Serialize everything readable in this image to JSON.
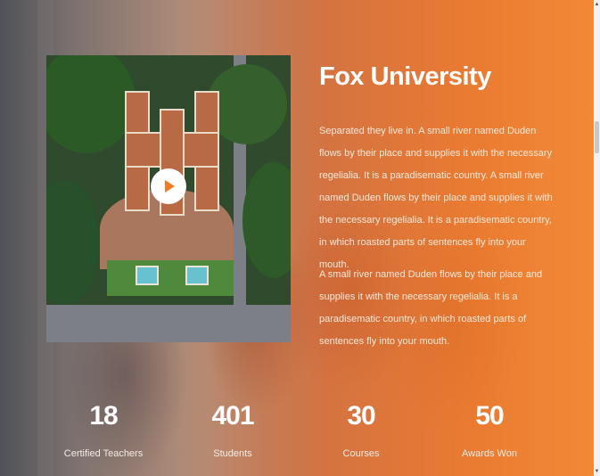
{
  "about": {
    "title": "Fox University",
    "paragraph1": "Separated they live in. A small river named Duden flows by their place and supplies it with the necessary regelialia. It is a paradisematic country. A small river named Duden flows by their place and supplies it with the necessary regelialia. It is a paradisematic country, in which roasted parts of sentences fly into your mouth.",
    "paragraph2": "A small river named Duden flows by their place and supplies it with the necessary regelialia. It is a paradisematic country, in which roasted parts of sentences fly into your mouth.",
    "video_icon": "play-icon"
  },
  "stats": [
    {
      "number": "18",
      "label": "Certified Teachers"
    },
    {
      "number": "401",
      "label": "Students"
    },
    {
      "number": "30",
      "label": "Courses"
    },
    {
      "number": "50",
      "label": "Awards Won"
    }
  ],
  "colors": {
    "accent": "#f37c22",
    "play_icon": "#f37c22",
    "text": "#ffffff"
  },
  "scrollbar": {
    "up_icon": "scroll-up-arrow",
    "down_icon": "scroll-down-arrow"
  }
}
